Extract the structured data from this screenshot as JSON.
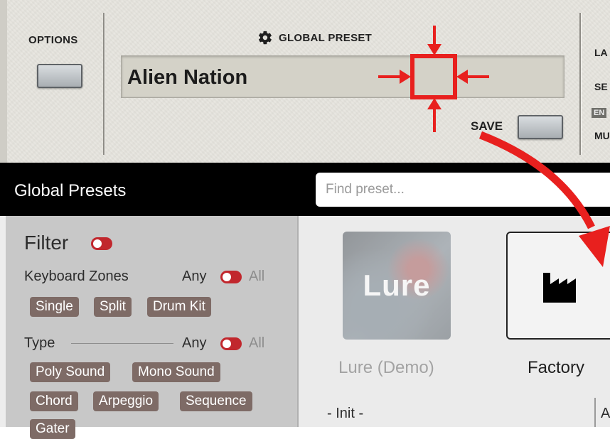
{
  "panel": {
    "options_label": "OPTIONS",
    "global_preset_label": "GLOBAL PRESET",
    "preset_name": "Alien Nation",
    "save_label": "SAVE",
    "right_labels": [
      "LA",
      "SE",
      "EN",
      "MU"
    ]
  },
  "browser": {
    "title": "Global Presets",
    "search_placeholder": "Find preset...",
    "filter": {
      "title": "Filter",
      "keyboard_zones": {
        "label": "Keyboard Zones",
        "any": "Any",
        "all": "All",
        "chips": [
          "Single",
          "Split",
          "Drum Kit"
        ]
      },
      "type": {
        "label": "Type",
        "any": "Any",
        "all": "All",
        "chips": [
          "Poly Sound",
          "Mono Sound",
          "Chord",
          "Arpeggio",
          "Sequence",
          "Gater"
        ]
      }
    },
    "libraries": [
      {
        "tile_text": "Lure",
        "caption": "Lure (Demo)"
      },
      {
        "tile_text": "",
        "caption": "Factory"
      }
    ],
    "list": {
      "first_item": "- Init -",
      "second_column_start": "A"
    }
  },
  "colors": {
    "accent_red": "#e8201e",
    "toggle_red": "#c1272d",
    "chip_brown": "#7e6b66",
    "panel_bg": "#e7e5df"
  },
  "icons": [
    "gear-icon",
    "factory-icon",
    "crosshair-annotation",
    "curved-arrow-annotation"
  ]
}
